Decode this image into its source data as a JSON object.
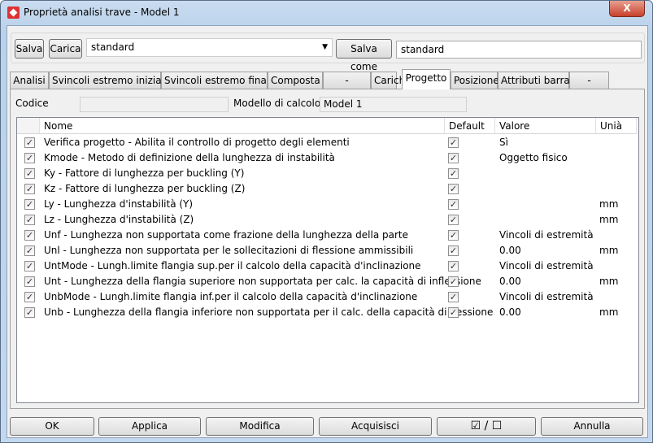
{
  "window": {
    "title": "Proprietà analisi trave - Model 1",
    "close_label": "X"
  },
  "toolbar": {
    "save": "Salva",
    "load": "Carica",
    "preset": "standard",
    "save_as": "Salva come",
    "save_as_name": "standard"
  },
  "tabs": [
    "Analisi",
    "Svincoli estremo iniziale",
    "Svincoli estremo finale",
    "Composta",
    "-",
    "Carichi",
    "Progetto",
    "Posizione",
    "Attributi barra",
    "-"
  ],
  "active_tab": "Progetto",
  "info": {
    "code_label": "Codice",
    "code_value": "",
    "model_label": "Modello di calcolo",
    "model_value": "Model 1"
  },
  "table": {
    "headers": [
      "Nome",
      "Default",
      "Valore",
      "Unià"
    ],
    "rows": [
      {
        "checked": true,
        "name": "Verifica progetto - Abilita il controllo di progetto degli elementi",
        "default": true,
        "value": "Sì",
        "unit": ""
      },
      {
        "checked": true,
        "name": "Kmode - Metodo di definizione della lunghezza di instabilità",
        "default": true,
        "value": "Oggetto fisico",
        "unit": ""
      },
      {
        "checked": true,
        "name": "Ky - Fattore di lunghezza per buckling (Y)",
        "default": true,
        "value": "",
        "unit": ""
      },
      {
        "checked": true,
        "name": "Kz - Fattore di lunghezza per buckling (Z)",
        "default": true,
        "value": "",
        "unit": ""
      },
      {
        "checked": true,
        "name": "Ly - Lunghezza d'instabilità (Y)",
        "default": true,
        "value": "",
        "unit": "mm"
      },
      {
        "checked": true,
        "name": "Lz - Lunghezza d'instabilità (Z)",
        "default": true,
        "value": "",
        "unit": "mm"
      },
      {
        "checked": true,
        "name": "Unf - Lunghezza non supportata come frazione della lunghezza della parte",
        "default": true,
        "value": "Vincoli di estremità",
        "unit": ""
      },
      {
        "checked": true,
        "name": "Unl - Lunghezza non supportata per le sollecitazioni di flessione ammissibili",
        "default": true,
        "value": "0.00",
        "unit": "mm"
      },
      {
        "checked": true,
        "name": "UntMode - Lungh.limite flangia sup.per il calcolo della capacità d'inclinazione",
        "default": true,
        "value": "Vincoli di estremità",
        "unit": ""
      },
      {
        "checked": true,
        "name": "Unt - Lunghezza della flangia superiore non supportata per calc. la capacità di inflessione",
        "default": true,
        "value": "0.00",
        "unit": "mm"
      },
      {
        "checked": true,
        "name": "UnbMode - Lungh.limite flangia inf.per il calcolo della capacità d'inclinazione",
        "default": true,
        "value": "Vincoli di estremità",
        "unit": ""
      },
      {
        "checked": true,
        "name": "Unb - Lunghezza della flangia inferiore non supportata per il calc. della capacità di flessione",
        "default": true,
        "value": "0.00",
        "unit": "mm"
      }
    ]
  },
  "footer": {
    "ok": "OK",
    "apply": "Applica",
    "modify": "Modifica",
    "acquire": "Acquisisci",
    "toggle": "☑ / ☐",
    "cancel": "Annulla"
  }
}
